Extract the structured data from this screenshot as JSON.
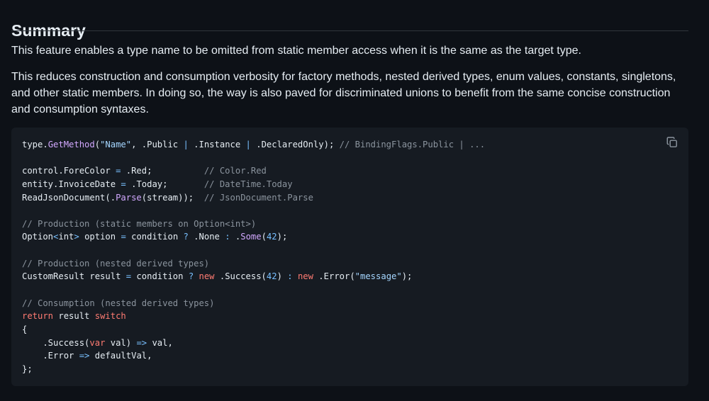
{
  "summary": {
    "heading": "Summary",
    "paragraph1": "This feature enables a type name to be omitted from static member access when it is the same as the target type.",
    "paragraph2": "This reduces construction and consumption verbosity for factory methods, nested derived types, enum values, constants, singletons, and other static members. In doing so, the way is also paved for discriminated unions to benefit from the same concise construction and consumption syntaxes."
  },
  "code_block": {
    "copy_icon": "copy-icon",
    "lines": [
      [
        [
          "plain",
          "type."
        ],
        [
          "method",
          "GetMethod"
        ],
        [
          "plain",
          "("
        ],
        [
          "string",
          "\"Name\""
        ],
        [
          "plain",
          ", .Public "
        ],
        [
          "op",
          "|"
        ],
        [
          "plain",
          " .Instance "
        ],
        [
          "op",
          "|"
        ],
        [
          "plain",
          " .DeclaredOnly); "
        ],
        [
          "comment",
          "// BindingFlags.Public | ..."
        ]
      ],
      [],
      [
        [
          "plain",
          "control.ForeColor "
        ],
        [
          "op",
          "="
        ],
        [
          "plain",
          " .Red;          "
        ],
        [
          "comment",
          "// Color.Red"
        ]
      ],
      [
        [
          "plain",
          "entity.InvoiceDate "
        ],
        [
          "op",
          "="
        ],
        [
          "plain",
          " .Today;       "
        ],
        [
          "comment",
          "// DateTime.Today"
        ]
      ],
      [
        [
          "plain",
          "ReadJsonDocument(."
        ],
        [
          "method",
          "Parse"
        ],
        [
          "plain",
          "(stream));  "
        ],
        [
          "comment",
          "// JsonDocument.Parse"
        ]
      ],
      [],
      [
        [
          "comment",
          "// Production (static members on Option<int>)"
        ]
      ],
      [
        [
          "plain",
          "Option"
        ],
        [
          "op",
          "<"
        ],
        [
          "plain",
          "int"
        ],
        [
          "op",
          ">"
        ],
        [
          "plain",
          " option "
        ],
        [
          "op",
          "="
        ],
        [
          "plain",
          " condition "
        ],
        [
          "op",
          "?"
        ],
        [
          "plain",
          " .None "
        ],
        [
          "op",
          ":"
        ],
        [
          "plain",
          " ."
        ],
        [
          "method",
          "Some"
        ],
        [
          "plain",
          "("
        ],
        [
          "num",
          "42"
        ],
        [
          "plain",
          ");"
        ]
      ],
      [],
      [
        [
          "comment",
          "// Production (nested derived types)"
        ]
      ],
      [
        [
          "plain",
          "CustomResult result "
        ],
        [
          "op",
          "="
        ],
        [
          "plain",
          " condition "
        ],
        [
          "op",
          "?"
        ],
        [
          "plain",
          " "
        ],
        [
          "kw",
          "new"
        ],
        [
          "plain",
          " .Success("
        ],
        [
          "num",
          "42"
        ],
        [
          "plain",
          ") "
        ],
        [
          "op",
          ":"
        ],
        [
          "plain",
          " "
        ],
        [
          "kw",
          "new"
        ],
        [
          "plain",
          " .Error("
        ],
        [
          "string",
          "\"message\""
        ],
        [
          "plain",
          ");"
        ]
      ],
      [],
      [
        [
          "comment",
          "// Consumption (nested derived types)"
        ]
      ],
      [
        [
          "kw",
          "return"
        ],
        [
          "plain",
          " result "
        ],
        [
          "kw",
          "switch"
        ]
      ],
      [
        [
          "plain",
          "{"
        ]
      ],
      [
        [
          "plain",
          "    .Success("
        ],
        [
          "kw",
          "var"
        ],
        [
          "plain",
          " val) "
        ],
        [
          "op",
          "=>"
        ],
        [
          "plain",
          " val,"
        ]
      ],
      [
        [
          "plain",
          "    .Error "
        ],
        [
          "op",
          "=>"
        ],
        [
          "plain",
          " defaultVal,"
        ]
      ],
      [
        [
          "plain",
          "};"
        ]
      ]
    ]
  }
}
